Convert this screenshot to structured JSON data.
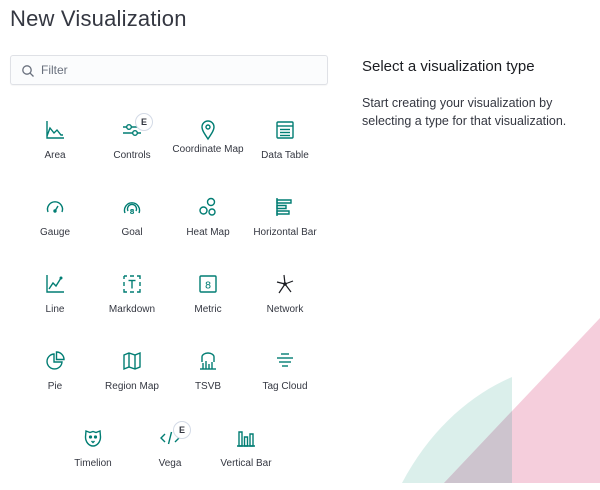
{
  "page": {
    "title": "New Visualization"
  },
  "filter": {
    "placeholder": "Filter",
    "value": ""
  },
  "side": {
    "title": "Select a visualization type",
    "description": "Start creating your visualization by selecting a type for that visualization."
  },
  "colors": {
    "icon": "#017d73",
    "text": "#343741",
    "accent_teal": "#b9e2dd",
    "accent_pink": "#f0b8cc"
  },
  "types": [
    {
      "label": "Area",
      "icon": "area-chart-icon"
    },
    {
      "label": "Controls",
      "icon": "controls-icon",
      "badge": "E"
    },
    {
      "label": "Coordinate Map",
      "icon": "map-pin-icon"
    },
    {
      "label": "Data Table",
      "icon": "data-table-icon"
    },
    {
      "label": "Gauge",
      "icon": "gauge-icon"
    },
    {
      "label": "Goal",
      "icon": "goal-icon"
    },
    {
      "label": "Heat Map",
      "icon": "heat-map-icon"
    },
    {
      "label": "Horizontal Bar",
      "icon": "horizontal-bar-icon"
    },
    {
      "label": "Line",
      "icon": "line-chart-icon"
    },
    {
      "label": "Markdown",
      "icon": "markdown-icon"
    },
    {
      "label": "Metric",
      "icon": "metric-icon"
    },
    {
      "label": "Network",
      "icon": "network-icon"
    },
    {
      "label": "Pie",
      "icon": "pie-chart-icon"
    },
    {
      "label": "Region Map",
      "icon": "region-map-icon"
    },
    {
      "label": "TSVB",
      "icon": "tsvb-icon"
    },
    {
      "label": "Tag Cloud",
      "icon": "tag-cloud-icon"
    },
    {
      "label": "Timelion",
      "icon": "timelion-icon"
    },
    {
      "label": "Vega",
      "icon": "vega-icon",
      "badge": "E"
    },
    {
      "label": "Vertical Bar",
      "icon": "vertical-bar-icon"
    }
  ]
}
